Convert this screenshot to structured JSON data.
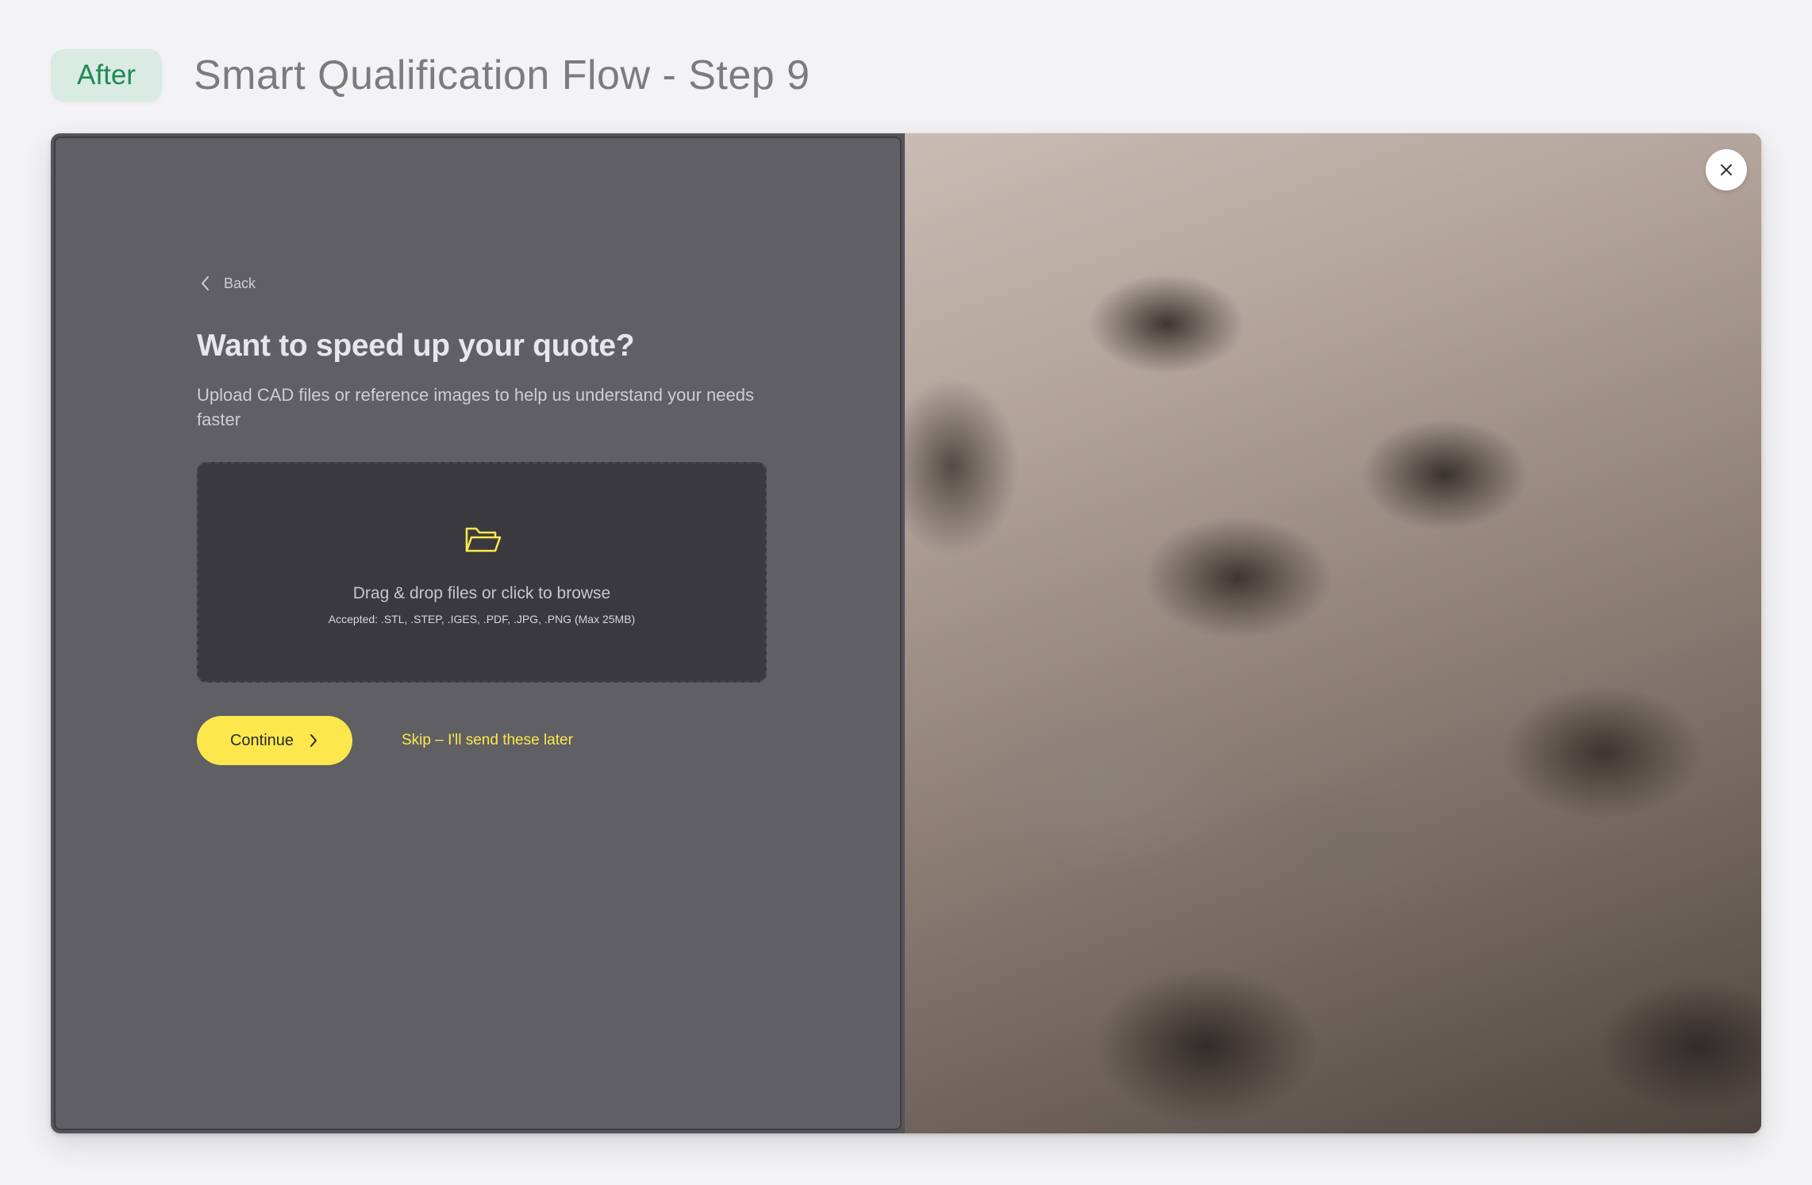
{
  "header": {
    "badge": "After",
    "title": "Smart Qualification Flow - Step 9"
  },
  "form": {
    "back_label": "Back",
    "headline": "Want to speed up your quote?",
    "subtext": "Upload CAD files or reference images to help us understand your needs faster",
    "dropzone": {
      "icon": "folder-open-icon",
      "main_text": "Drag & drop files or click to browse",
      "accepted_text": "Accepted: .STL, .STEP, .IGES, .PDF, .JPG, .PNG (Max 25MB)"
    },
    "continue_label": "Continue",
    "skip_label": "Skip – I'll send these later"
  },
  "image_panel": {
    "close_icon": "close-icon"
  },
  "colors": {
    "accent": "#fce84d",
    "badge_bg": "#d9ebe3",
    "badge_text": "#1f8a55",
    "panel_bg": "#605f64",
    "dropzone_bg": "#3a393d"
  }
}
